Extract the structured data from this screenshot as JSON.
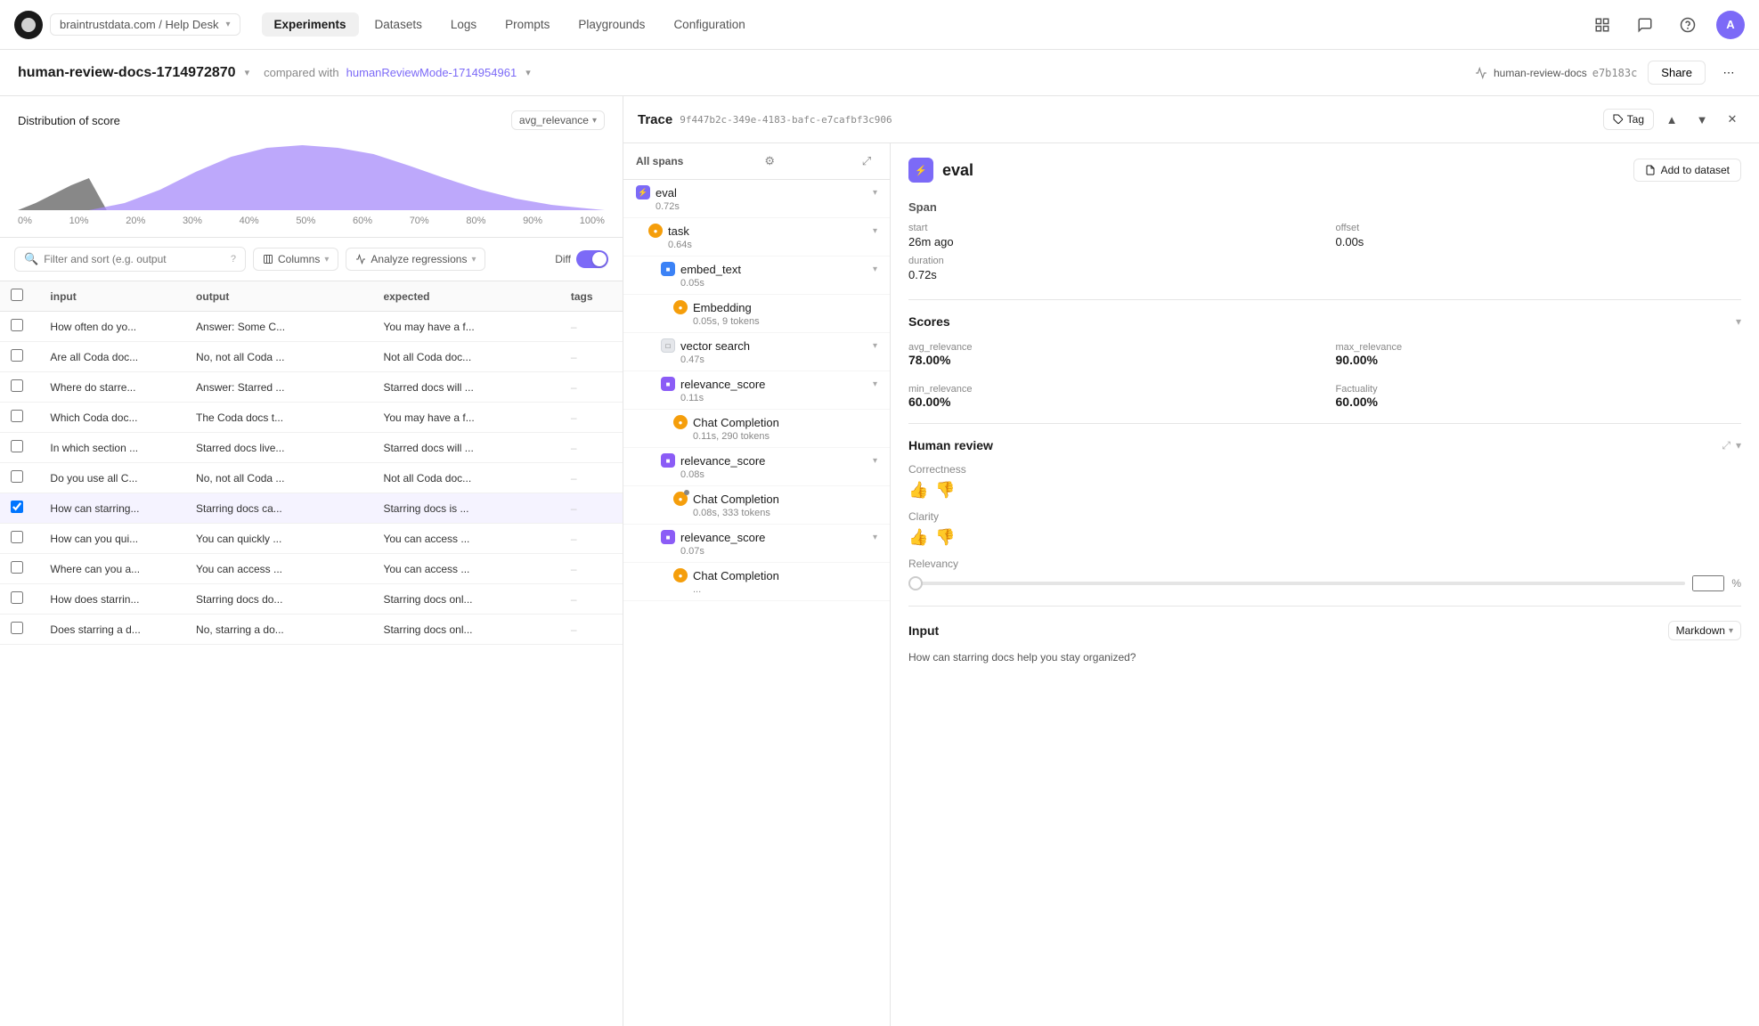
{
  "nav": {
    "logo_label": "BT",
    "breadcrumb": "braintrustdata.com / Help Desk",
    "links": [
      {
        "label": "Experiments",
        "active": true
      },
      {
        "label": "Datasets",
        "active": false
      },
      {
        "label": "Logs",
        "active": false
      },
      {
        "label": "Prompts",
        "active": false
      },
      {
        "label": "Playgrounds",
        "active": false
      },
      {
        "label": "Configuration",
        "active": false
      }
    ],
    "avatar_label": "A"
  },
  "sub_header": {
    "title": "human-review-docs-1714972870",
    "compared_text": "compared with",
    "compared_link": "humanReviewMode-1714954961",
    "repo_label": "human-review-docs",
    "repo_hash": "e7b183c",
    "share_label": "Share"
  },
  "distribution": {
    "title": "Distribution of score",
    "select_value": "avg_relevance",
    "x_labels": [
      "0%",
      "10%",
      "20%",
      "30%",
      "40%",
      "50%",
      "60%",
      "70%",
      "80%",
      "90%",
      "100%"
    ]
  },
  "toolbar": {
    "search_placeholder": "Filter and sort (e.g. output",
    "columns_label": "Columns",
    "analyze_label": "Analyze regressions",
    "diff_label": "Diff"
  },
  "table": {
    "columns": [
      "",
      "input",
      "output",
      "expected",
      "tags"
    ],
    "rows": [
      {
        "input": "How often do yo...",
        "output": "Answer: Some C...",
        "expected": "You may have a f...",
        "tags": "–",
        "selected": false
      },
      {
        "input": "Are all Coda doc...",
        "output": "No, not all Coda ...",
        "expected": "Not all Coda doc...",
        "tags": "–",
        "selected": false
      },
      {
        "input": "Where do starre...",
        "output": "Answer: Starred ...",
        "expected": "Starred docs will ...",
        "tags": "–",
        "selected": false
      },
      {
        "input": "Which Coda doc...",
        "output": "The Coda docs t...",
        "expected": "You may have a f...",
        "tags": "–",
        "selected": false
      },
      {
        "input": "In which section ...",
        "output": "Starred docs live...",
        "expected": "Starred docs will ...",
        "tags": "–",
        "selected": false
      },
      {
        "input": "Do you use all C...",
        "output": "No, not all Coda ...",
        "expected": "Not all Coda doc...",
        "tags": "–",
        "selected": false
      },
      {
        "input": "How can starring...",
        "output": "Starring docs ca...",
        "expected": "Starring docs is ...",
        "tags": "–",
        "selected": true
      },
      {
        "input": "How can you qui...",
        "output": "You can quickly ...",
        "expected": "You can access ...",
        "tags": "–",
        "selected": false
      },
      {
        "input": "Where can you a...",
        "output": "You can access ...",
        "expected": "You can access ...",
        "tags": "–",
        "selected": false
      },
      {
        "input": "How does starrin...",
        "output": "Starring docs do...",
        "expected": "Starring docs onl...",
        "tags": "–",
        "selected": false
      },
      {
        "input": "Does starring a d...",
        "output": "No, starring a do...",
        "expected": "Starring docs onl...",
        "tags": "–",
        "selected": false
      }
    ]
  },
  "trace": {
    "title": "Trace",
    "trace_id": "9f447b2c-349e-4183-bafc-e7cafbf3c906",
    "tag_label": "Tag",
    "spans_title": "All spans",
    "spans": [
      {
        "name": "eval",
        "time": "0.72s",
        "type": "eval",
        "indent": 0,
        "collapsed": false
      },
      {
        "name": "task",
        "time": "0.64s",
        "type": "task",
        "indent": 1,
        "collapsed": false
      },
      {
        "name": "embed_text",
        "time": "0.05s",
        "type": "embed",
        "indent": 2,
        "collapsed": false
      },
      {
        "name": "Embedding",
        "time": "0.05s, 9 tokens",
        "type": "embed",
        "indent": 3,
        "collapsed": false
      },
      {
        "name": "vector search",
        "time": "0.47s",
        "type": "vec",
        "indent": 2,
        "collapsed": false
      },
      {
        "name": "relevance_score",
        "time": "0.11s",
        "type": "rel",
        "indent": 2,
        "collapsed": false
      },
      {
        "name": "Chat Completion",
        "time": "0.11s, 290 tokens",
        "type": "chat",
        "indent": 3,
        "collapsed": false
      },
      {
        "name": "relevance_score",
        "time": "0.08s",
        "type": "rel",
        "indent": 2,
        "collapsed": false
      },
      {
        "name": "Chat Completion",
        "time": "0.08s, 333 tokens",
        "type": "chat",
        "indent": 3,
        "collapsed": false
      },
      {
        "name": "relevance_score",
        "time": "0.07s",
        "type": "rel",
        "indent": 2,
        "collapsed": false
      },
      {
        "name": "Chat Completion",
        "time": "...",
        "type": "chat",
        "indent": 3,
        "collapsed": false
      }
    ],
    "detail": {
      "span_name": "eval",
      "add_dataset_label": "Add to dataset",
      "span_title": "Span",
      "start_label": "start",
      "start_value": "26m ago",
      "offset_label": "offset",
      "offset_value": "0.00s",
      "duration_label": "duration",
      "duration_value": "0.72s",
      "scores_title": "Scores",
      "avg_relevance_label": "avg_relevance",
      "avg_relevance_value": "78.00%",
      "max_relevance_label": "max_relevance",
      "max_relevance_value": "90.00%",
      "min_relevance_label": "min_relevance",
      "min_relevance_value": "60.00%",
      "factuality_label": "Factuality",
      "factuality_value": "60.00%",
      "human_review_title": "Human review",
      "correctness_label": "Correctness",
      "clarity_label": "Clarity",
      "relevancy_label": "Relevancy",
      "pct_placeholder": "",
      "pct_sign": "%",
      "input_title": "Input",
      "markdown_label": "Markdown"
    }
  }
}
